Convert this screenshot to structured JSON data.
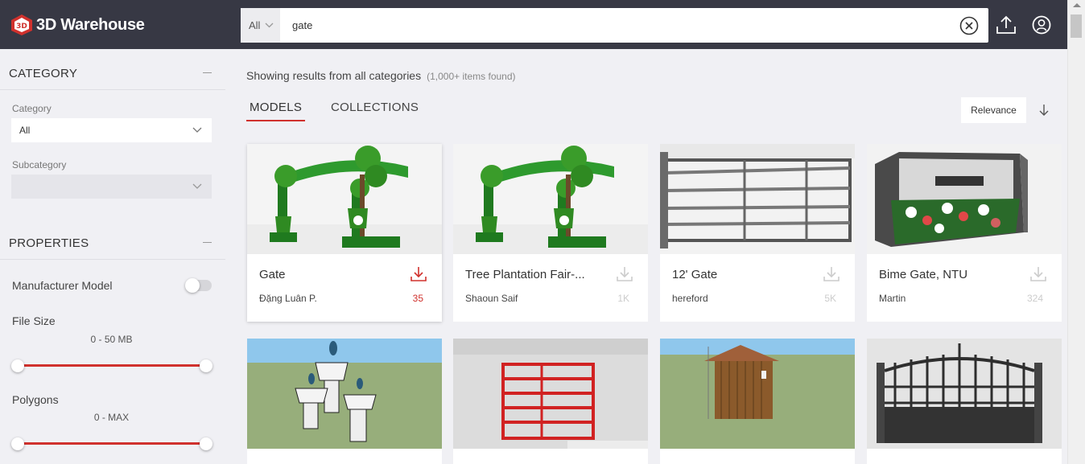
{
  "header": {
    "brand": "3D Warehouse",
    "search_scope": "All",
    "search_query": "gate"
  },
  "sidebar": {
    "category_section": "CATEGORY",
    "category_label": "Category",
    "category_value": "All",
    "subcategory_label": "Subcategory",
    "subcategory_value": "",
    "properties_section": "PROPERTIES",
    "manufacturer_label": "Manufacturer Model",
    "manufacturer_on": false,
    "file_size_label": "File Size",
    "file_size_range": "0 - 50 MB",
    "polygons_label": "Polygons",
    "polygons_range": "0 - MAX"
  },
  "main": {
    "results_text": "Showing results from all categories",
    "results_count": "(1,000+ items found)",
    "tabs": [
      "MODELS",
      "COLLECTIONS"
    ],
    "active_tab": "MODELS",
    "sort_label": "Relevance"
  },
  "cards": [
    {
      "title": "Gate",
      "author": "Đặng Luân P.",
      "downloads": "35"
    },
    {
      "title": "Tree Plantation Fair-...",
      "author": "Shaoun Saif",
      "downloads": "1K"
    },
    {
      "title": "12' Gate",
      "author": "hereford",
      "downloads": "5K"
    },
    {
      "title": "Bime Gate, NTU",
      "author": "Martin",
      "downloads": "324"
    }
  ],
  "colors": {
    "header_bg": "#373844",
    "accent": "#d0312d",
    "page_bg": "#f0f0f4"
  }
}
